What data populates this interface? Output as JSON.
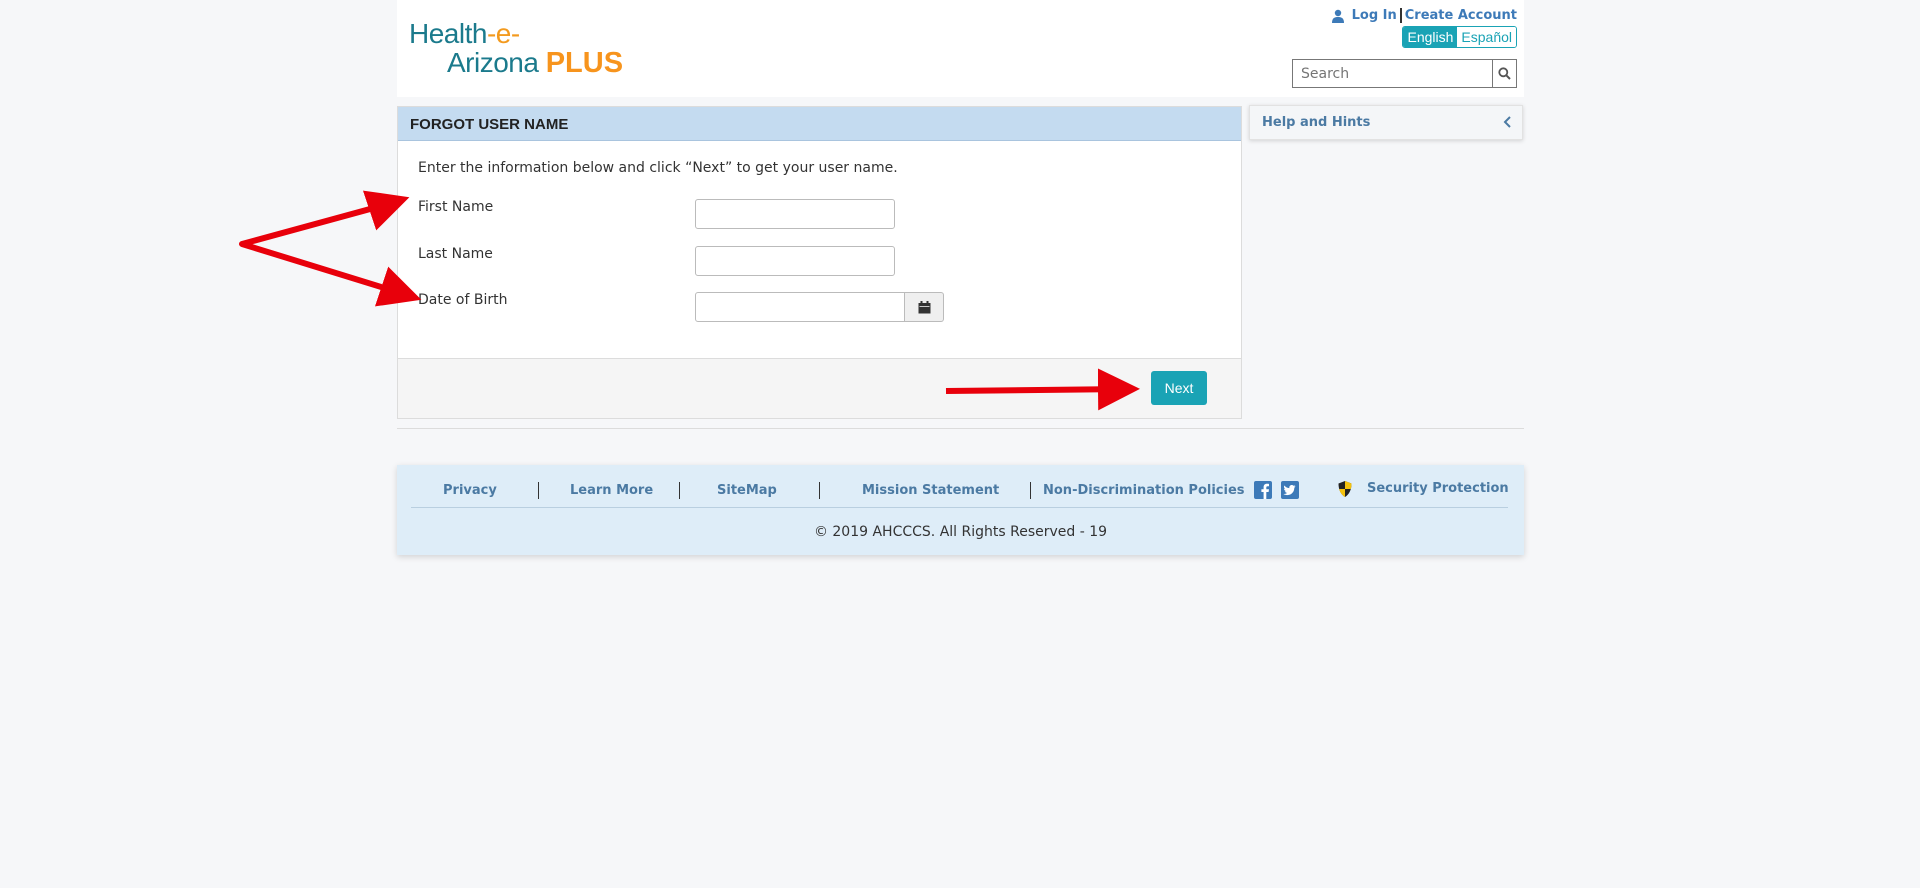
{
  "header": {
    "logo": {
      "line1_a": "Health",
      "line1_b": "-e-",
      "line2": "Arizona",
      "plus": "PLUS"
    },
    "log_in": "Log In",
    "create_account": "Create Account",
    "lang_english": "English",
    "lang_spanish": "Español",
    "search_placeholder": "Search"
  },
  "form": {
    "title": "FORGOT USER NAME",
    "intro": "Enter the information below and click “Next” to get your user name.",
    "first_name_label": "First Name",
    "last_name_label": "Last Name",
    "dob_label": "Date of Birth",
    "first_name_value": "",
    "last_name_value": "",
    "dob_value": "",
    "next_label": "Next"
  },
  "help": {
    "title": "Help and Hints"
  },
  "footer": {
    "links": {
      "privacy": "Privacy",
      "learn_more": "Learn More",
      "sitemap": "SiteMap",
      "mission": "Mission Statement",
      "non_discrimination": "Non-Discrimination Policies",
      "security": "Security Protection"
    },
    "copyright": "© 2019 AHCCCS. All Rights Reserved - 19"
  },
  "icons": {
    "user": "user-icon",
    "search": "search-icon",
    "calendar": "calendar-icon",
    "chevron": "chevron-left-icon",
    "facebook": "facebook-icon",
    "twitter": "twitter-icon",
    "shield": "shield-icon"
  },
  "colors": {
    "brand_teal": "#1aa3b5",
    "logo_teal": "#1b7a8c",
    "logo_orange": "#f7941d",
    "link_blue": "#4b7aa3",
    "panel_header": "#c4dbf0",
    "footer_bg": "#deedf8",
    "annotation_red": "#e8000b"
  }
}
